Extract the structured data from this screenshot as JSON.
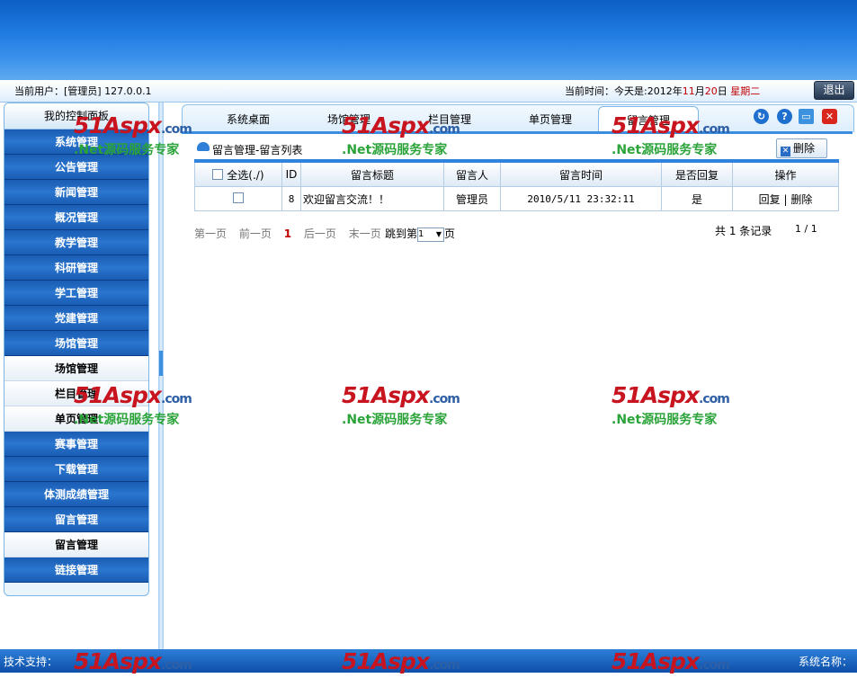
{
  "header": {
    "current_user": "当前用户：[管理员]  127.0.0.1",
    "time_prefix": "当前时间：今天是:2012年",
    "month": "11",
    "month_suffix": "月",
    "day": "20",
    "day_suffix": "日",
    "weekday": "星期二",
    "logout": "退出"
  },
  "sidebar": {
    "title": "我的控制面板",
    "items": [
      {
        "label": "系统管理",
        "kind": "cat"
      },
      {
        "label": "公告管理",
        "kind": "cat"
      },
      {
        "label": "新闻管理",
        "kind": "cat"
      },
      {
        "label": "概况管理",
        "kind": "cat"
      },
      {
        "label": "教学管理",
        "kind": "cat"
      },
      {
        "label": "科研管理",
        "kind": "cat"
      },
      {
        "label": "学工管理",
        "kind": "cat"
      },
      {
        "label": "党建管理",
        "kind": "cat"
      },
      {
        "label": "场馆管理",
        "kind": "cat"
      },
      {
        "label": "场馆管理",
        "kind": "sub"
      },
      {
        "label": "栏目管理",
        "kind": "sub"
      },
      {
        "label": "单页管理",
        "kind": "sub"
      },
      {
        "label": "赛事管理",
        "kind": "cat"
      },
      {
        "label": "下载管理",
        "kind": "cat"
      },
      {
        "label": "体测成绩管理",
        "kind": "cat"
      },
      {
        "label": "留言管理",
        "kind": "cat"
      },
      {
        "label": "留言管理",
        "kind": "sub"
      },
      {
        "label": "链接管理",
        "kind": "cat"
      }
    ]
  },
  "tabs": [
    "系统桌面",
    "场馆管理",
    "栏目管理",
    "单页管理",
    "留言管理"
  ],
  "active_tab": 4,
  "content": {
    "breadcrumb": "留言管理-留言列表",
    "delete_button": "删除",
    "table": {
      "select_all": "全选(./)",
      "headers": [
        "ID",
        "留言标题",
        "留言人",
        "留言时间",
        "是否回复",
        "操作"
      ],
      "rows": [
        {
          "id": "8",
          "title": "欢迎留言交流！！",
          "author": "管理员",
          "time": "2010/5/11 23:32:11",
          "replied": "是",
          "reply": "回复",
          "separator": "|",
          "delete": "删除"
        }
      ]
    },
    "pager": {
      "first": "第一页",
      "prev": "前一页",
      "current": "1",
      "next": "后一页",
      "last": "末一页",
      "jump_prefix": "跳到第",
      "jump_value": "1",
      "jump_suffix": "页",
      "total": "共 1 条记录",
      "pages": "1 / 1"
    }
  },
  "footer": {
    "left": "技术支持：",
    "right": "系统名称："
  },
  "watermark": {
    "brand": "51Aspx",
    "domain": ".com",
    "slogan": ".Net源码服务专家"
  },
  "colors": {
    "banner": "#1f7ae0",
    "sidebar_category": "#1a5cb3",
    "accent_red": "#c00000",
    "table_top": "#2f83dc"
  }
}
